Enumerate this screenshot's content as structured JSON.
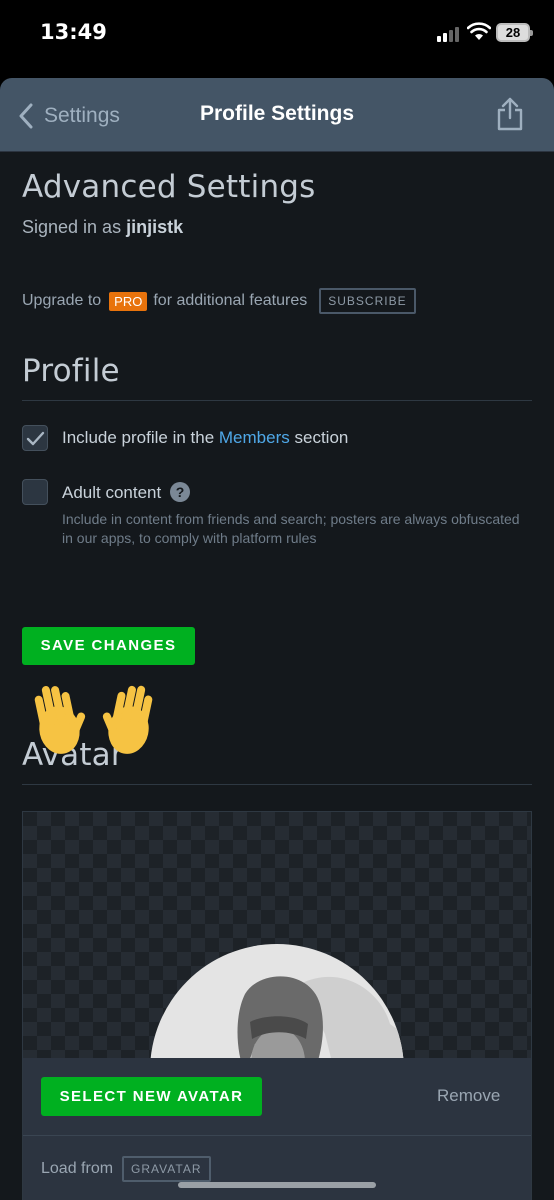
{
  "status_bar": {
    "time": "13:49",
    "battery": "28",
    "icons": [
      "signal-icon",
      "wifi-icon",
      "battery-icon"
    ]
  },
  "nav": {
    "back_label": "Settings",
    "title": "Profile Settings",
    "icons": [
      "chevron-left-icon",
      "share-icon"
    ]
  },
  "advanced": {
    "heading": "Advanced Settings",
    "signed_in_prefix": "Signed in as",
    "username": "jinjistk",
    "upgrade_prefix": "Upgrade to",
    "pro_badge": "PRO",
    "upgrade_suffix": "for additional features",
    "subscribe_label": "SUBSCRIBE"
  },
  "profile": {
    "heading": "Profile",
    "include_prefix": "Include profile in the",
    "include_link": "Members",
    "include_suffix": "section",
    "include_checked": true,
    "adult_label": "Adult content",
    "adult_checked": false,
    "help_glyph": "?",
    "adult_help": "Include in content from friends and search; posters are always obfuscated in our apps, to comply with platform rules",
    "save_label": "SAVE CHANGES"
  },
  "emoji": {
    "hands": "raised-hands-emoji"
  },
  "avatar": {
    "heading": "Avatar",
    "select_label": "SELECT NEW AVATAR",
    "remove_label": "Remove",
    "load_from_label": "Load from",
    "gravatar_label": "GRAVATAR"
  },
  "colors": {
    "accent_green": "#00b020",
    "pro_orange": "#e8730c",
    "link_blue": "#4fa8e8",
    "nav_bg": "#445566",
    "page_bg": "#14181c"
  }
}
